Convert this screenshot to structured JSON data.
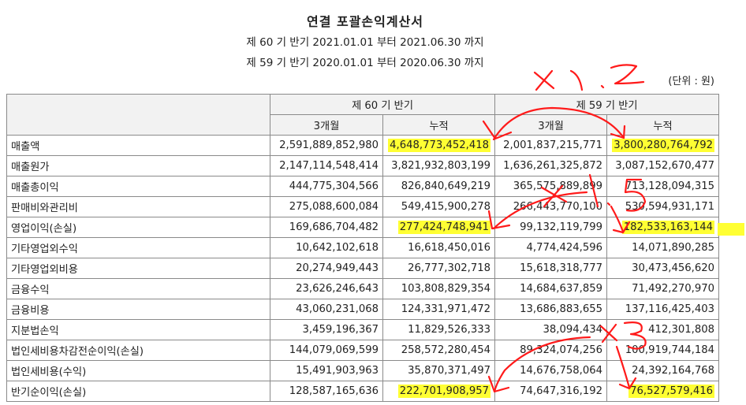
{
  "header": {
    "title": "연결 포괄손익계산서",
    "period1": "제 60 기 반기 2021.01.01 부터 2021.06.30 까지",
    "period2": "제 59 기 반기 2020.01.01 부터 2020.06.30 까지",
    "unit": "(단위 : 원)"
  },
  "table": {
    "group1": "제 60 기 반기",
    "group2": "제 59 기 반기",
    "sub": [
      "3개월",
      "누적",
      "3개월",
      "누적"
    ],
    "rows": [
      {
        "label": "매출액",
        "v": [
          "2,591,889,852,980",
          "4,648,773,452,418",
          "2,001,837,215,771",
          "3,800,280,764,792"
        ]
      },
      {
        "label": "매출원가",
        "v": [
          "2,147,114,548,414",
          "3,821,932,803,199",
          "1,636,261,325,872",
          "3,087,152,670,477"
        ]
      },
      {
        "label": "매출총이익",
        "v": [
          "444,775,304,566",
          "826,840,649,219",
          "365,575,889,899",
          "713,128,094,315"
        ]
      },
      {
        "label": "판매비와관리비",
        "v": [
          "275,088,600,084",
          "549,415,900,278",
          "266,443,770,100",
          "530,594,931,171"
        ]
      },
      {
        "label": "영업이익(손실)",
        "v": [
          "169,686,704,482",
          "277,424,748,941",
          "99,132,119,799",
          "182,533,163,144"
        ]
      },
      {
        "label": "기타영업외수익",
        "v": [
          "10,642,102,618",
          "16,618,450,016",
          "4,774,424,596",
          "14,071,890,285"
        ]
      },
      {
        "label": "기타영업외비용",
        "v": [
          "20,274,949,443",
          "26,777,302,718",
          "15,618,318,777",
          "30,473,456,620"
        ]
      },
      {
        "label": "금융수익",
        "v": [
          "23,626,246,643",
          "103,808,829,354",
          "14,684,637,859",
          "71,492,270,970"
        ]
      },
      {
        "label": "금융비용",
        "v": [
          "43,060,231,068",
          "124,331,971,472",
          "13,686,883,655",
          "137,116,425,403"
        ]
      },
      {
        "label": "지분법손익",
        "v": [
          "3,459,196,367",
          "11,829,526,333",
          "38,094,434",
          "412,301,808"
        ]
      },
      {
        "label": "법인세비용차감전순이익(손실)",
        "v": [
          "144,079,069,599",
          "258,572,280,454",
          "89,324,074,256",
          "100,919,744,184"
        ]
      },
      {
        "label": "법인세비용(수익)",
        "v": [
          "15,491,903,963",
          "35,870,371,497",
          "14,676,758,064",
          "24,392,164,768"
        ]
      },
      {
        "label": "반기순이익(손실)",
        "v": [
          "128,587,165,636",
          "222,701,908,957",
          "74,647,316,192",
          "76,527,579,416"
        ]
      }
    ],
    "highlight_cells": [
      [
        0,
        1
      ],
      [
        0,
        3
      ],
      [
        4,
        1
      ],
      [
        4,
        3
      ],
      [
        12,
        1
      ],
      [
        12,
        3
      ]
    ],
    "highlight_color": "#ffff33"
  },
  "annotations": {
    "ink_color": "#ff1a1a",
    "marks": [
      "x1.2",
      "x1.5",
      "x3"
    ]
  }
}
